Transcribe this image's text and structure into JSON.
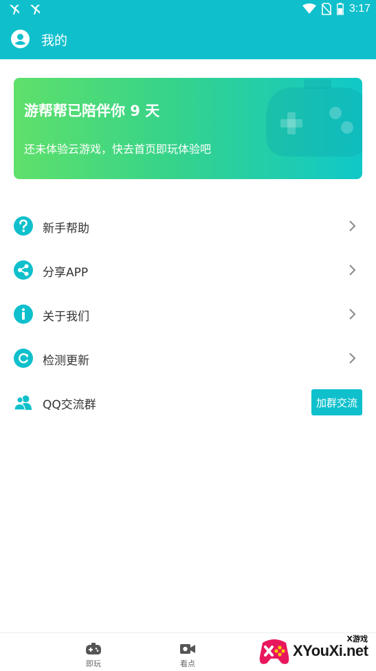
{
  "status_bar": {
    "time": "3:17",
    "icons": [
      "notification-icon",
      "notification-icon",
      "wifi-icon",
      "no-sim-icon",
      "battery-icon"
    ]
  },
  "app_bar": {
    "title": "我的",
    "icon": "profile-icon"
  },
  "banner": {
    "headline": "游帮帮已陪伴你 9 天",
    "subline": "还未体验云游戏，快去首页即玩体验吧",
    "icon": "gamepad-icon"
  },
  "menu": [
    {
      "label": "新手帮助",
      "icon": "help-icon"
    },
    {
      "label": "分享APP",
      "icon": "share-icon"
    },
    {
      "label": "关于我们",
      "icon": "info-icon"
    },
    {
      "label": "检测更新",
      "icon": "refresh-icon"
    },
    {
      "label": "QQ交流群",
      "icon": "group-icon",
      "button": "加群交流"
    }
  ],
  "bottom_nav": {
    "tabs": [
      {
        "label": "即玩",
        "icon": "gamepad-icon"
      },
      {
        "label": "看点",
        "icon": "video-icon"
      }
    ]
  },
  "watermark": {
    "sub": "X游戏",
    "main": "XYouXi.net"
  },
  "colors": {
    "accent": "#0fc0cc",
    "banner_start": "#5fe06a",
    "banner_end": "#10c8c8",
    "text": "#333333",
    "chevron": "#888888"
  }
}
